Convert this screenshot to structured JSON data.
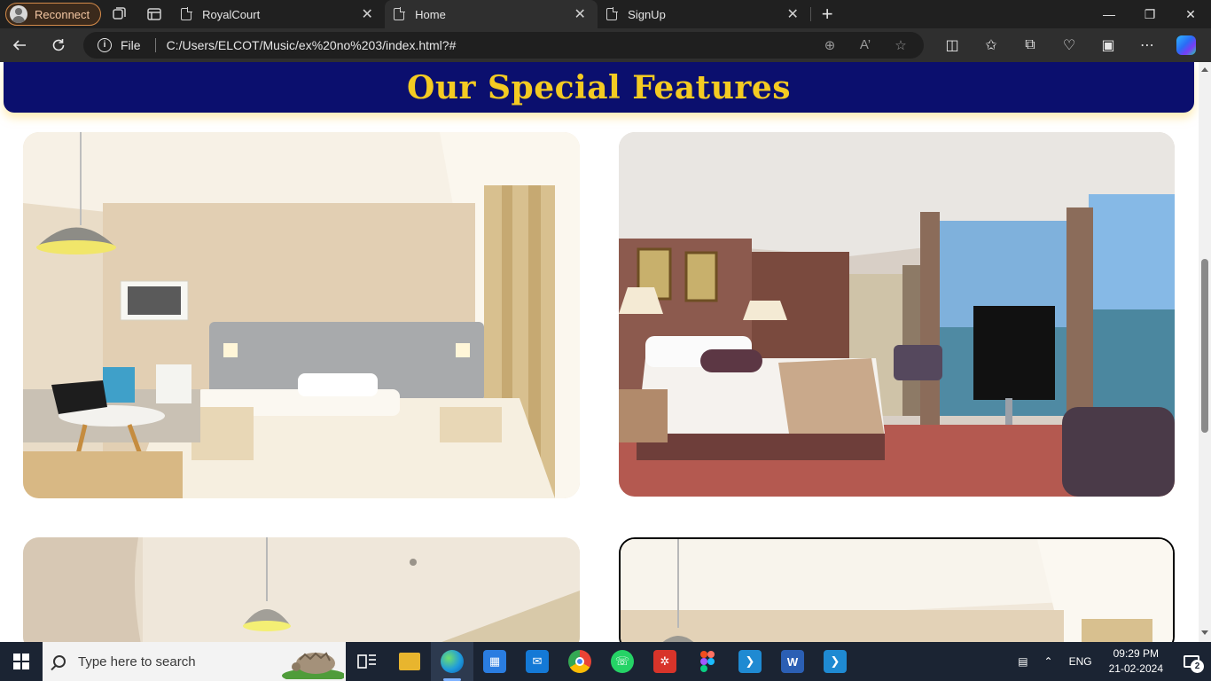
{
  "browser": {
    "profile_label": "Reconnect",
    "tabs": [
      {
        "title": "RoyalCourt",
        "active": false
      },
      {
        "title": "Home",
        "active": true
      },
      {
        "title": "SignUp",
        "active": false
      }
    ],
    "close_glyph": "✕",
    "address": {
      "scheme": "File",
      "url": "C:/Users/ELCOT/Music/ex%20no%203/index.html?#"
    }
  },
  "page": {
    "heading": "Our Special Features",
    "colors": {
      "banner_bg": "#0b0f6e",
      "heading": "#f4cb22"
    },
    "photos": [
      {
        "alt": "hotel room with bed, lamp and laptop"
      },
      {
        "alt": "luxury suite with sea view and TV"
      },
      {
        "alt": "hotel room ceiling with pendant lamp"
      },
      {
        "alt": "hotel room with pendant lamp"
      }
    ]
  },
  "taskbar": {
    "search_placeholder": "Type here to search",
    "language": "ENG",
    "time": "09:29 PM",
    "date": "21-02-2024",
    "notification_count": "2",
    "apps": [
      "task-view",
      "file-explorer",
      "edge",
      "microsoft-store",
      "mail",
      "chrome",
      "whatsapp",
      "app-red",
      "figma",
      "vscode",
      "word",
      "vscode"
    ]
  }
}
